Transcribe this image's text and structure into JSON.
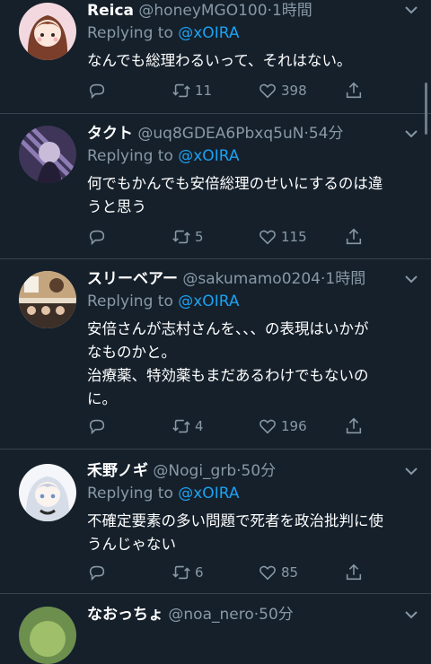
{
  "tweets": [
    {
      "name": "Reica",
      "handle": "@honeyMGO100",
      "sep": "·",
      "time": "1時間",
      "replying_label": "Replying to",
      "mention": "@xOIRA",
      "text": "なんでも総理わるいって、それはない。",
      "retweets": "11",
      "likes": "398",
      "avatar_color": "#e9b8c4"
    },
    {
      "name": "タクト",
      "handle": "@uq8GDEA6Pbxq5uN",
      "sep": "·",
      "time": "54分",
      "replying_label": "Replying to",
      "mention": "@xOIRA",
      "text": "何でもかんでも安倍総理のせいにするのは違\nうと思う",
      "retweets": "5",
      "likes": "115",
      "avatar_color": "#6d5a8f"
    },
    {
      "name": "スリーベアー",
      "handle": "@sakumamo0204",
      "sep": "·",
      "time": "1時間",
      "replying_label": "Replying to",
      "mention": "@xOIRA",
      "text": "安倍さんが志村さんを、、、の表現はいかが\nなものかと。\n治療薬、特効薬もまだあるわけでもないの\nに。",
      "retweets": "4",
      "likes": "196",
      "avatar_color": "#b89a78"
    },
    {
      "name": "禾野ノギ",
      "handle": "@Nogi_grb",
      "sep": "·",
      "time": "50分",
      "replying_label": "Replying to",
      "mention": "@xOIRA",
      "text": "不確定要素の多い問題で死者を政治批判に使\nうんじゃない",
      "retweets": "6",
      "likes": "85",
      "avatar_color": "#dfe6f0"
    },
    {
      "name": "なおっちょ",
      "handle": "@noa_nero",
      "sep": "·",
      "time": "50分",
      "avatar_color": "#6c8f4e"
    }
  ],
  "colors": {
    "background": "#15202b",
    "secondary": "#8899a6",
    "accent": "#1da1f2",
    "divider": "#38444d"
  },
  "icons": {
    "reply": "reply-icon",
    "retweet": "retweet-icon",
    "like": "like-icon",
    "share": "share-icon",
    "menu": "chevron-down-icon"
  }
}
